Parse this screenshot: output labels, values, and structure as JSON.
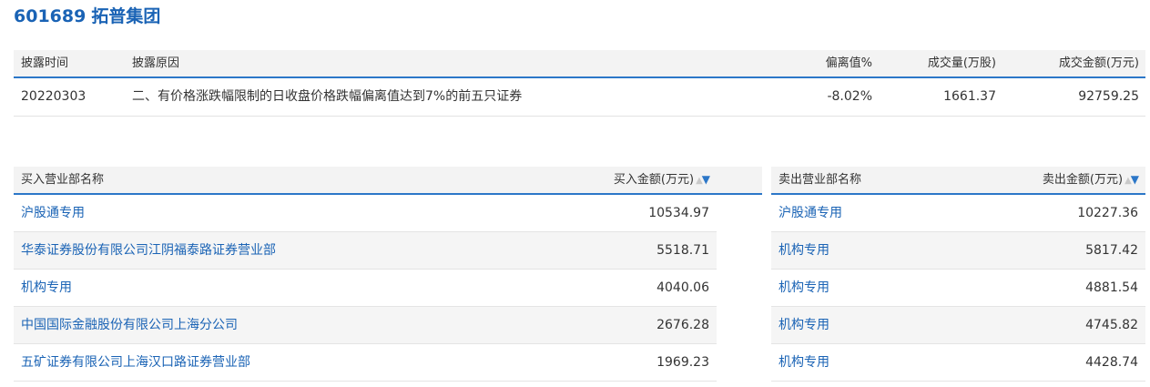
{
  "stock": {
    "code": "601689",
    "name": "拓普集团"
  },
  "disclosure": {
    "headers": {
      "time": "披露时间",
      "reason": "披露原因",
      "deviation": "偏离值%",
      "volume": "成交量(万股)",
      "amount": "成交金额(万元)"
    },
    "row": {
      "time": "20220303",
      "reason": "二、有价格涨跌幅限制的日收盘价格跌幅偏离值达到7%的前五只证券",
      "deviation": "-8.02%",
      "volume": "1661.37",
      "amount": "92759.25"
    }
  },
  "buy": {
    "headers": {
      "name": "买入营业部名称",
      "amount": "买入金额(万元)"
    },
    "rows": [
      {
        "name": "沪股通专用",
        "amount": "10534.97"
      },
      {
        "name": "华泰证券股份有限公司江阴福泰路证券营业部",
        "amount": "5518.71"
      },
      {
        "name": "机构专用",
        "amount": "4040.06"
      },
      {
        "name": "中国国际金融股份有限公司上海分公司",
        "amount": "2676.28"
      },
      {
        "name": "五矿证券有限公司上海汉口路证券营业部",
        "amount": "1969.23"
      }
    ]
  },
  "sell": {
    "headers": {
      "name": "卖出营业部名称",
      "amount": "卖出金额(万元)"
    },
    "rows": [
      {
        "name": "沪股通专用",
        "amount": "10227.36"
      },
      {
        "name": "机构专用",
        "amount": "5817.42"
      },
      {
        "name": "机构专用",
        "amount": "4881.54"
      },
      {
        "name": "机构专用",
        "amount": "4745.82"
      },
      {
        "name": "机构专用",
        "amount": "4428.74"
      }
    ]
  },
  "sort_icons": {
    "up": "triangle-up-icon",
    "down": "triangle-down-icon"
  },
  "colors": {
    "accent": "#1a63b5",
    "header_border": "#2c77c8",
    "header_bg": "#f3f3f3",
    "alt_row_bg": "#f5f5f5"
  }
}
